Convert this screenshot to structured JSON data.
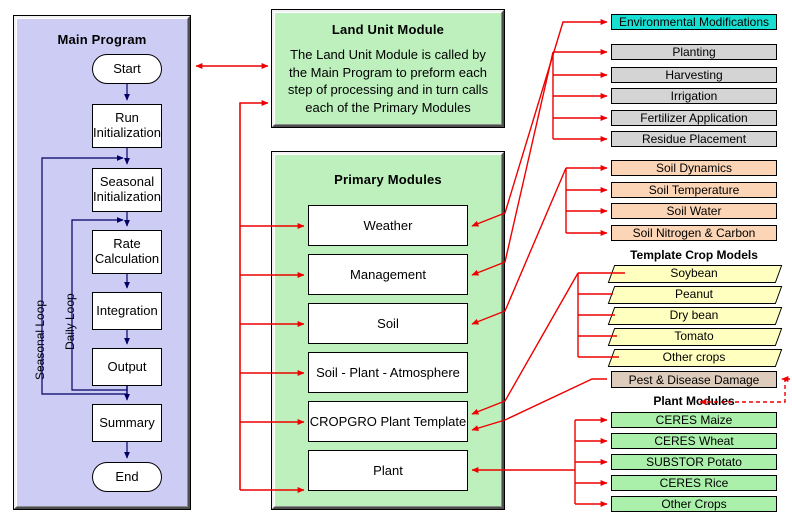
{
  "main_program": {
    "title": "Main Program",
    "loops": [
      {
        "id": "seasonal",
        "label": "Seasonal Loop"
      },
      {
        "id": "daily",
        "label": "Daily Loop"
      }
    ],
    "nodes": [
      {
        "id": "start",
        "label": "Start",
        "shape": "terminator"
      },
      {
        "id": "runinit",
        "label": "Run Initialization",
        "shape": "process"
      },
      {
        "id": "seasinit",
        "label": "Seasonal Initialization",
        "shape": "process"
      },
      {
        "id": "rate",
        "label": "Rate Calculation",
        "shape": "process"
      },
      {
        "id": "integ",
        "label": "Integration",
        "shape": "process"
      },
      {
        "id": "output",
        "label": "Output",
        "shape": "process"
      },
      {
        "id": "summary",
        "label": "Summary",
        "shape": "process"
      },
      {
        "id": "end",
        "label": "End",
        "shape": "terminator"
      }
    ]
  },
  "land_unit_module": {
    "title": "Land Unit Module",
    "body": "The Land Unit Module is called by the Main Program to preform each step of processing and in turn calls each of the Primary Modules"
  },
  "primary_modules": {
    "title": "Primary Modules",
    "items": [
      {
        "id": "weather",
        "label": "Weather"
      },
      {
        "id": "management",
        "label": "Management"
      },
      {
        "id": "soil",
        "label": "Soil"
      },
      {
        "id": "spa",
        "label": "Soil - Plant - Atmosphere"
      },
      {
        "id": "cropgro",
        "label": "CROPGRO Plant Template"
      },
      {
        "id": "plant",
        "label": "Plant"
      }
    ]
  },
  "weather_group": {
    "items": [
      {
        "id": "envmod",
        "label": "Environmental Modifications"
      }
    ]
  },
  "management_group": {
    "items": [
      {
        "id": "planting",
        "label": "Planting"
      },
      {
        "id": "harvesting",
        "label": "Harvesting"
      },
      {
        "id": "irrigation",
        "label": "Irrigation"
      },
      {
        "id": "fertilizer",
        "label": "Fertilizer Application"
      },
      {
        "id": "residue",
        "label": "Residue Placement"
      }
    ]
  },
  "soil_group": {
    "items": [
      {
        "id": "soildyn",
        "label": "Soil Dynamics"
      },
      {
        "id": "soiltemp",
        "label": "Soil Temperature"
      },
      {
        "id": "soilwater",
        "label": "Soil Water"
      },
      {
        "id": "soilnc",
        "label": "Soil Nitrogen & Carbon"
      }
    ]
  },
  "template_crop_models": {
    "title": "Template Crop Models",
    "items": [
      {
        "id": "soybean",
        "label": "Soybean"
      },
      {
        "id": "peanut",
        "label": "Peanut"
      },
      {
        "id": "drybean",
        "label": "Dry bean"
      },
      {
        "id": "tomato",
        "label": "Tomato"
      },
      {
        "id": "othercrops",
        "label": "Other crops"
      }
    ]
  },
  "pest_disease": {
    "label": "Pest & Disease Damage"
  },
  "plant_modules": {
    "title": "Plant Modules",
    "items": [
      {
        "id": "ceresmaize",
        "label": "CERES Maize"
      },
      {
        "id": "cereswheat",
        "label": "CERES Wheat"
      },
      {
        "id": "substorpotato",
        "label": "SUBSTOR Potato"
      },
      {
        "id": "ceresrice",
        "label": "CERES Rice"
      },
      {
        "id": "othercrops2",
        "label": "Other Crops"
      }
    ]
  },
  "colors": {
    "main_panel": "#ccccf5",
    "module_panel": "#bdf0bd",
    "environmental": "#17e0d2",
    "management": "#d4d4d4",
    "soil": "#fbd5b5",
    "crop_template": "#ffffbf",
    "pest": "#ddccbb",
    "plant_module": "#aaf0aa",
    "connector": "#ee0000",
    "flow_line": "#000066"
  }
}
